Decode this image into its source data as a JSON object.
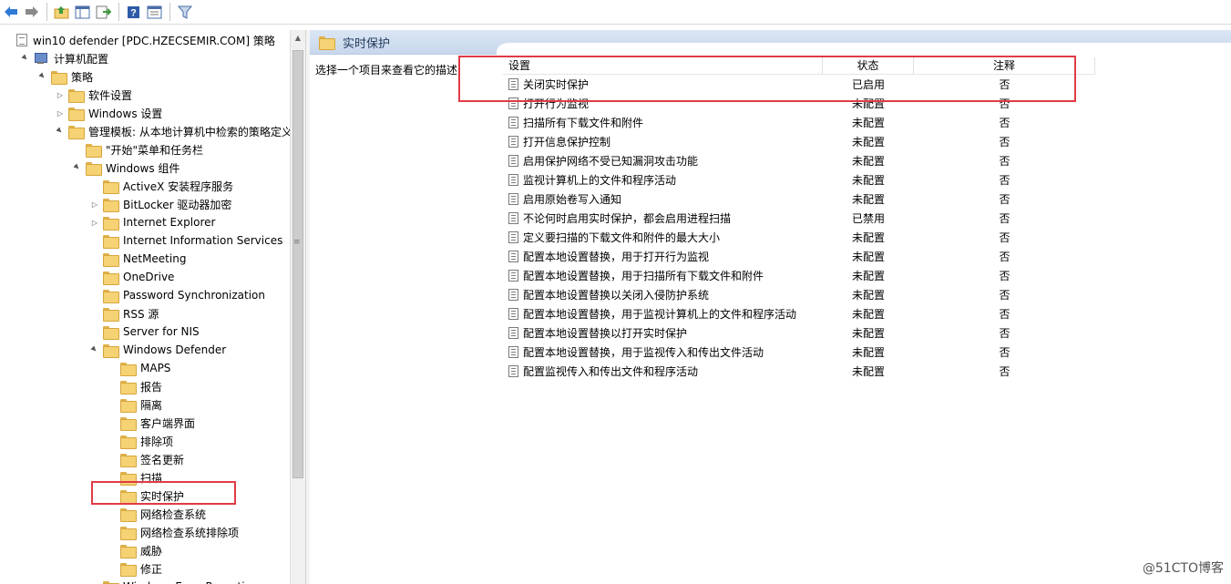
{
  "toolbar": {
    "buttons": [
      "back-icon",
      "forward-icon",
      "up-folder-icon",
      "show-hide-tree-icon",
      "export-list-icon",
      "help-icon",
      "properties-icon",
      "filter-icon"
    ]
  },
  "tree": {
    "items": [
      {
        "label": "win10 defender [PDC.HZECSEMIR.COM] 策略",
        "icon": "policy-doc-icon",
        "twisty": ""
      },
      {
        "label": "计算机配置",
        "icon": "computer-icon",
        "twisty": "▲"
      },
      {
        "label": "策略",
        "icon": "folder-icon",
        "twisty": "▲"
      },
      {
        "label": "软件设置",
        "icon": "folder-icon",
        "twisty": "▷"
      },
      {
        "label": "Windows 设置",
        "icon": "folder-icon",
        "twisty": "▷"
      },
      {
        "label": "管理模板: 从本地计算机中检索的策略定义(Al",
        "icon": "folder-icon",
        "twisty": "▲"
      },
      {
        "label": "\"开始\"菜单和任务栏",
        "icon": "folder-icon",
        "twisty": ""
      },
      {
        "label": "Windows 组件",
        "icon": "folder-icon",
        "twisty": "▲"
      },
      {
        "label": "ActiveX 安装程序服务",
        "icon": "folder-icon",
        "twisty": ""
      },
      {
        "label": "BitLocker 驱动器加密",
        "icon": "folder-icon",
        "twisty": "▷"
      },
      {
        "label": "Internet Explorer",
        "icon": "folder-icon",
        "twisty": "▷"
      },
      {
        "label": "Internet Information Services",
        "icon": "folder-icon",
        "twisty": ""
      },
      {
        "label": "NetMeeting",
        "icon": "folder-icon",
        "twisty": ""
      },
      {
        "label": "OneDrive",
        "icon": "folder-icon",
        "twisty": ""
      },
      {
        "label": "Password Synchronization",
        "icon": "folder-icon",
        "twisty": ""
      },
      {
        "label": "RSS 源",
        "icon": "folder-icon",
        "twisty": ""
      },
      {
        "label": "Server for NIS",
        "icon": "folder-icon",
        "twisty": ""
      },
      {
        "label": "Windows Defender",
        "icon": "folder-icon",
        "twisty": "▲"
      },
      {
        "label": "MAPS",
        "icon": "folder-icon",
        "twisty": ""
      },
      {
        "label": "报告",
        "icon": "folder-icon",
        "twisty": ""
      },
      {
        "label": "隔离",
        "icon": "folder-icon",
        "twisty": ""
      },
      {
        "label": "客户端界面",
        "icon": "folder-icon",
        "twisty": ""
      },
      {
        "label": "排除项",
        "icon": "folder-icon",
        "twisty": ""
      },
      {
        "label": "签名更新",
        "icon": "folder-icon",
        "twisty": ""
      },
      {
        "label": "扫描",
        "icon": "folder-icon",
        "twisty": ""
      },
      {
        "label": "实时保护",
        "icon": "folder-icon",
        "twisty": "",
        "selected": true
      },
      {
        "label": "网络检查系统",
        "icon": "folder-icon",
        "twisty": ""
      },
      {
        "label": "网络检查系统排除项",
        "icon": "folder-icon",
        "twisty": ""
      },
      {
        "label": "威胁",
        "icon": "folder-icon",
        "twisty": ""
      },
      {
        "label": "修正",
        "icon": "folder-icon",
        "twisty": ""
      },
      {
        "label": "Windows Error Reporting",
        "icon": "folder-icon",
        "twisty": ""
      }
    ]
  },
  "right": {
    "header_title": "实时保护",
    "description": "选择一个项目来查看它的描述",
    "columns": [
      "设置",
      "状态",
      "注释"
    ],
    "rows": [
      {
        "setting": "关闭实时保护",
        "state": "已启用",
        "comment": "否"
      },
      {
        "setting": "打开行为监视",
        "state": "未配置",
        "comment": "否"
      },
      {
        "setting": "扫描所有下载文件和附件",
        "state": "未配置",
        "comment": "否"
      },
      {
        "setting": "打开信息保护控制",
        "state": "未配置",
        "comment": "否"
      },
      {
        "setting": "启用保护网络不受已知漏洞攻击功能",
        "state": "未配置",
        "comment": "否"
      },
      {
        "setting": "监视计算机上的文件和程序活动",
        "state": "未配置",
        "comment": "否"
      },
      {
        "setting": "启用原始卷写入通知",
        "state": "未配置",
        "comment": "否"
      },
      {
        "setting": "不论何时启用实时保护，都会启用进程扫描",
        "state": "已禁用",
        "comment": "否"
      },
      {
        "setting": "定义要扫描的下载文件和附件的最大大小",
        "state": "未配置",
        "comment": "否"
      },
      {
        "setting": "配置本地设置替换，用于打开行为监视",
        "state": "未配置",
        "comment": "否"
      },
      {
        "setting": "配置本地设置替换，用于扫描所有下载文件和附件",
        "state": "未配置",
        "comment": "否"
      },
      {
        "setting": "配置本地设置替换以关闭入侵防护系统",
        "state": "未配置",
        "comment": "否"
      },
      {
        "setting": "配置本地设置替换，用于监视计算机上的文件和程序活动",
        "state": "未配置",
        "comment": "否"
      },
      {
        "setting": "配置本地设置替换以打开实时保护",
        "state": "未配置",
        "comment": "否"
      },
      {
        "setting": "配置本地设置替换，用于监视传入和传出文件活动",
        "state": "未配置",
        "comment": "否"
      },
      {
        "setting": "配置监视传入和传出文件和程序活动",
        "state": "未配置",
        "comment": "否"
      }
    ]
  },
  "watermark": "@51CTO博客",
  "colors": {
    "highlight": "#e03b45",
    "header_band": "#c8d7ec",
    "folder": "#f5d273"
  }
}
